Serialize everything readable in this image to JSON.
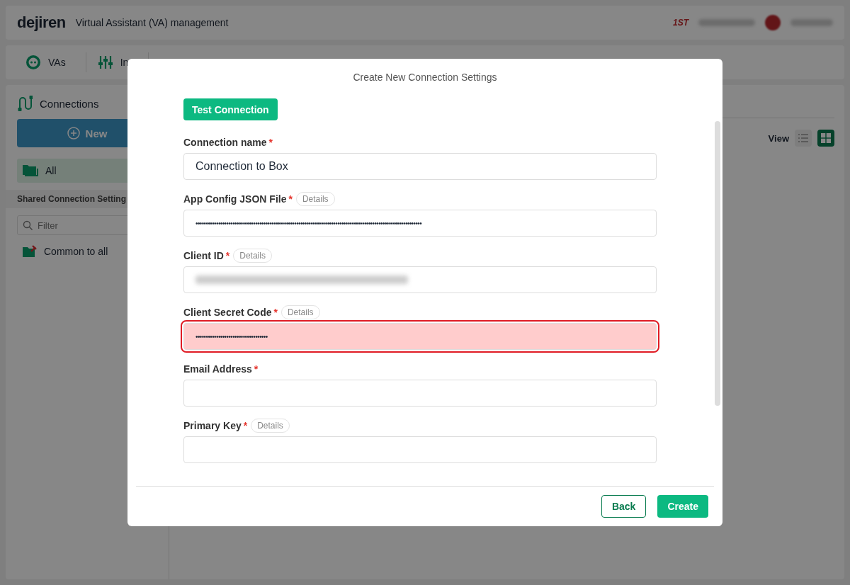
{
  "header": {
    "logo": "dejiren",
    "title": "Virtual Assistant (VA) management",
    "badge": "1ST"
  },
  "nav": [
    {
      "label": "VAs",
      "selected": false
    },
    {
      "label": "In",
      "selected": false
    }
  ],
  "sidebar": {
    "title": "Connections",
    "new_button": "New",
    "items": [
      {
        "label": "All",
        "selected": true
      }
    ],
    "section": "Shared Connection Setting",
    "filter_placeholder": "Filter",
    "shared": [
      {
        "label": "Common to all"
      }
    ]
  },
  "content": {
    "view_label": "View",
    "views": [
      {
        "kind": "list",
        "selected": false
      },
      {
        "kind": "grid",
        "selected": true
      }
    ]
  },
  "dialog": {
    "title": "Create New Connection Settings",
    "test_button": "Test Connection",
    "fields": [
      {
        "label": "Connection name",
        "required": "*",
        "kind": "text",
        "value": "Connection to Box",
        "error": false
      },
      {
        "label": "App Config JSON File",
        "required": "*",
        "details": "Details",
        "kind": "secret",
        "value": "••••••••••••••••••••••••••••••••••••••••••••••••••••••••••••••••••••••••••••••••••••••••••••••••••••••••••••••",
        "error": false
      },
      {
        "label": "Client ID",
        "required": "*",
        "details": "Details",
        "kind": "obscured",
        "error": false
      },
      {
        "label": "Client Secret Code",
        "required": "*",
        "details": "Details",
        "kind": "secret",
        "value": "•••••••••••••••••••••••••••••••••••",
        "error": true
      },
      {
        "label": "Email Address",
        "required": "*",
        "kind": "text",
        "error": false
      },
      {
        "label": "Primary Key",
        "required": "*",
        "details": "Details",
        "kind": "text",
        "error": false
      }
    ],
    "buttons": [
      {
        "label": "Back",
        "kind": "outline"
      },
      {
        "label": "Create",
        "kind": "primary"
      }
    ]
  }
}
